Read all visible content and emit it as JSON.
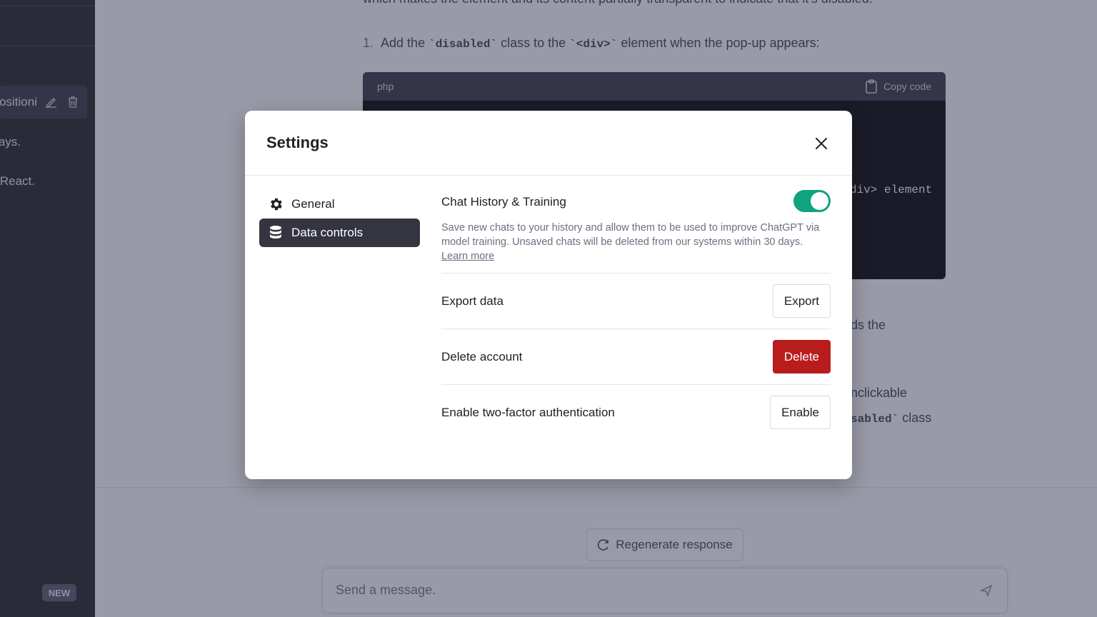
{
  "background": {
    "sidebar": {
      "chats": [
        "Positioni",
        "Arrays.",
        "in React."
      ],
      "new_badge": "NEW"
    },
    "main": {
      "top_text": "which makes the element and its content partially transparent to indicate that it's disabled.",
      "step": {
        "number": "1.",
        "pre": "Add the ",
        "code1": "`disabled`",
        "mid": " class to the ",
        "code2": "`<div>`",
        "post": " element when the pop-up appears:"
      },
      "code_block": {
        "language": "php",
        "copy_label": "Copy code",
        "visible_code": "div> element"
      },
      "fragments": {
        "a": "ds the",
        "b": "nclickable",
        "c_code": "sabled`",
        "c_text": " class"
      },
      "regenerate_label": "Regenerate response",
      "composer_placeholder": "Send a message."
    }
  },
  "settings": {
    "title": "Settings",
    "tabs": [
      {
        "label": "General",
        "icon": "gear-icon",
        "active": false
      },
      {
        "label": "Data controls",
        "icon": "database-icon",
        "active": true
      }
    ],
    "chat_history": {
      "title": "Chat History & Training",
      "enabled": true,
      "description": "Save new chats to your history and allow them to be used to improve ChatGPT via model training. Unsaved chats will be deleted from our systems within 30 days.",
      "learn_more": "Learn more"
    },
    "rows": [
      {
        "label": "Export data",
        "button": "Export"
      },
      {
        "label": "Delete account",
        "button": "Delete"
      },
      {
        "label": "Enable two-factor authentication",
        "button": "Enable"
      }
    ],
    "colors": {
      "accent": "#10a37f",
      "danger": "#b91c1c",
      "active_tab": "#343541"
    }
  }
}
